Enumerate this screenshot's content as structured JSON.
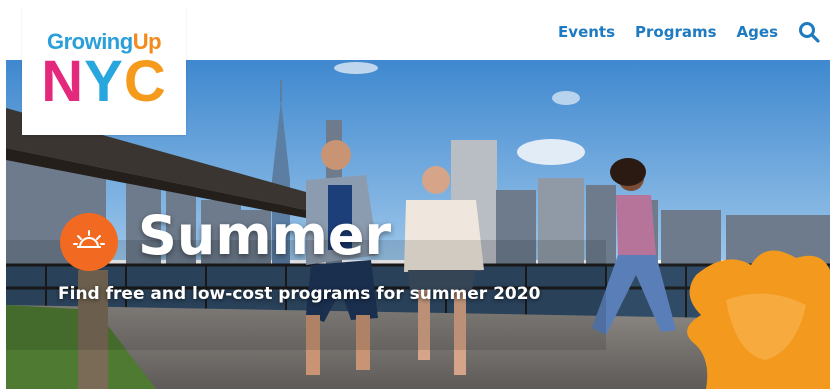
{
  "logo": {
    "line1_part1": "Growing",
    "line1_part2": "Up",
    "nyc_letters": [
      "N",
      "Y",
      "C"
    ]
  },
  "nav": {
    "items": [
      {
        "label": "Events"
      },
      {
        "label": "Programs"
      },
      {
        "label": "Ages"
      }
    ],
    "search_icon": "search-icon"
  },
  "hero": {
    "title": "Summer",
    "subtitle": "Find free and low-cost programs for summer 2020",
    "badge_icon": "sun-icon",
    "colors": {
      "accent_orange": "#f26a21",
      "link_blue": "#1f7bc1",
      "sky": "#4f95d4"
    }
  }
}
